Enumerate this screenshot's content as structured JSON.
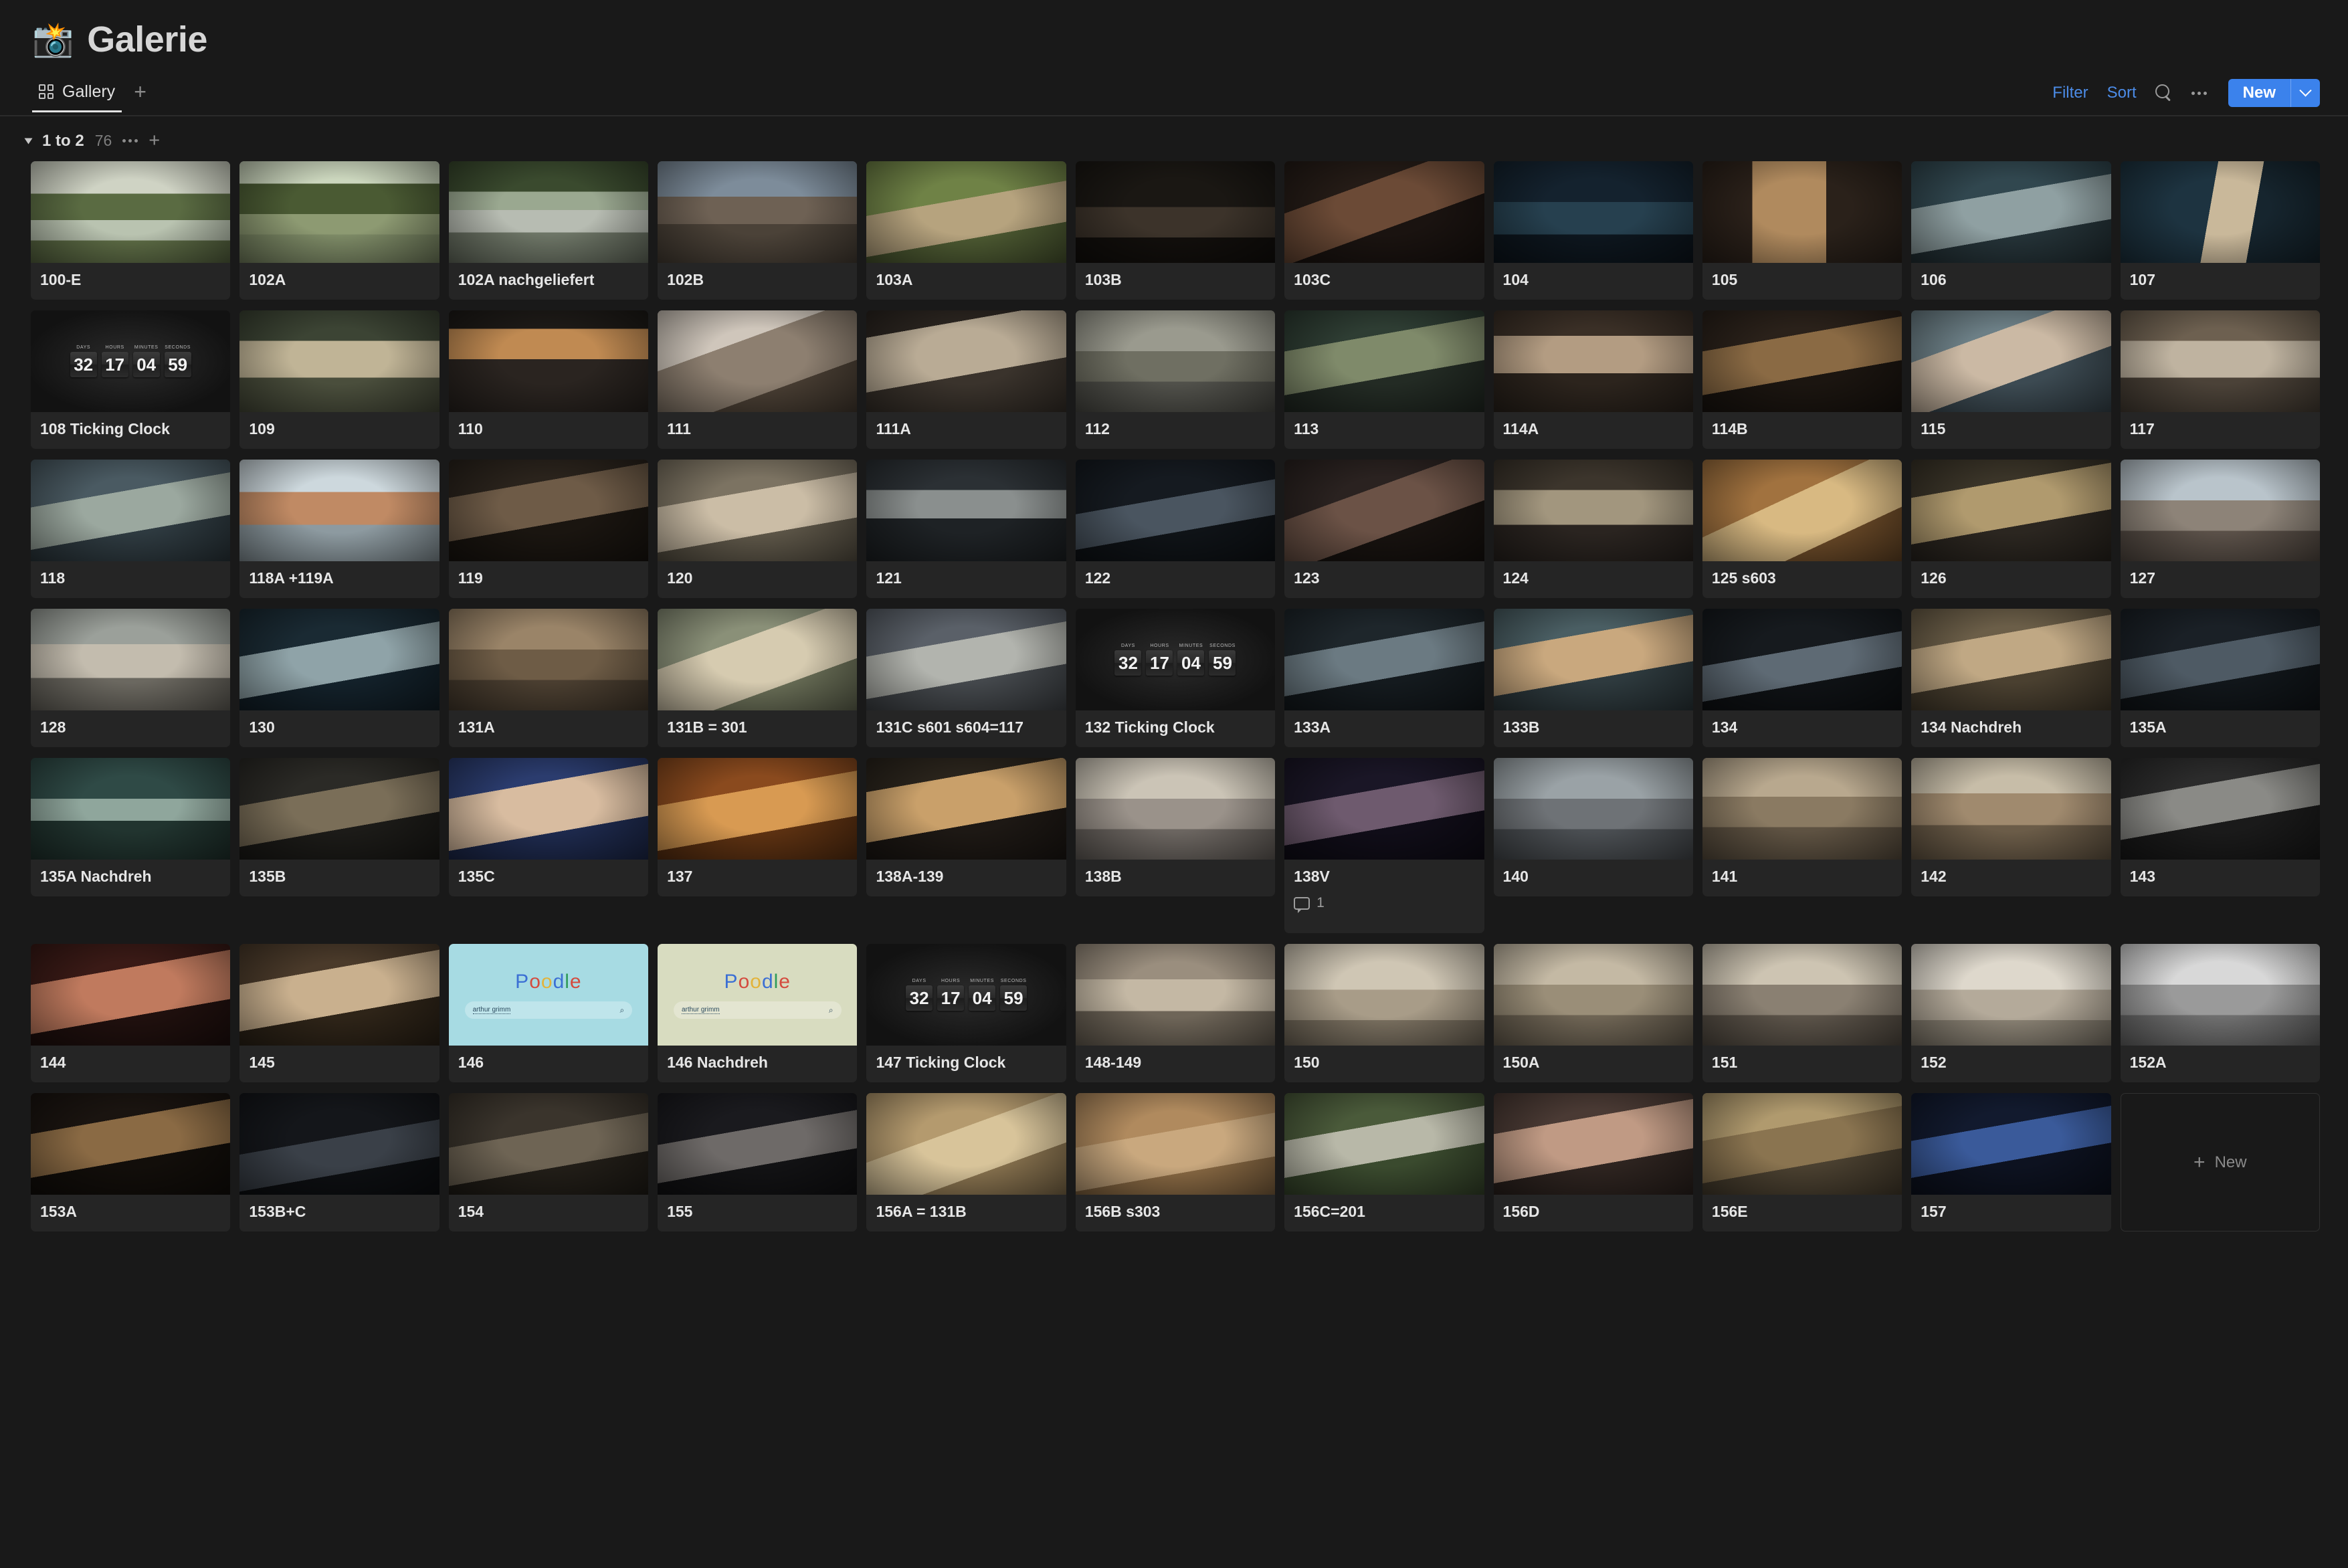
{
  "header": {
    "emoji": "📸",
    "emoji_name": "camera-with-flash",
    "title": "Galerie"
  },
  "viewbar": {
    "tabs": [
      {
        "label": "Gallery",
        "icon": "grid-icon",
        "active": true
      }
    ],
    "add_view_label": "+",
    "filter_label": "Filter",
    "sort_label": "Sort",
    "search_icon": "search-icon",
    "more_icon": "ellipsis-icon",
    "new_label": "New",
    "new_caret_icon": "chevron-down-icon",
    "accent_color": "#3b82ec",
    "link_color": "#4c8ce8"
  },
  "group": {
    "caret_icon": "triangle-down-icon",
    "name": "1 to 2",
    "count": "76",
    "more_icon": "ellipsis-icon",
    "add_icon": "plus-icon"
  },
  "clock": {
    "captions": [
      "DAYS",
      "HOURS",
      "MINUTES",
      "SECONDS"
    ],
    "values": [
      "32",
      "17",
      "04",
      "59"
    ]
  },
  "poodle": {
    "logo": "Poodle",
    "query": "arthur grimm",
    "search_icon": "magnifier-icon"
  },
  "new_card": {
    "plus": "+",
    "label": "New"
  },
  "cards": [
    {
      "label": "100-E",
      "art": "lake"
    },
    {
      "label": "102A",
      "art": "pavilion"
    },
    {
      "label": "102A nachgeliefert",
      "art": "bridge"
    },
    {
      "label": "102B",
      "art": "cyclists"
    },
    {
      "label": "103A",
      "art": "woman-garden"
    },
    {
      "label": "103B",
      "art": "dark-interior"
    },
    {
      "label": "103C",
      "art": "stairwell"
    },
    {
      "label": "104",
      "art": "dark-blue"
    },
    {
      "label": "105",
      "art": "window-woman"
    },
    {
      "label": "106",
      "art": "sleeping"
    },
    {
      "label": "107",
      "art": "blue-room"
    },
    {
      "label": "108 Ticking Clock",
      "art": "clock"
    },
    {
      "label": "109",
      "art": "group-outdoor"
    },
    {
      "label": "110",
      "art": "kitchen-woman"
    },
    {
      "label": "111",
      "art": "corridor-woman"
    },
    {
      "label": "111A",
      "art": "street-woman"
    },
    {
      "label": "112",
      "art": "facade"
    },
    {
      "label": "113",
      "art": "couple-embrace"
    },
    {
      "label": "114A",
      "art": "two-women"
    },
    {
      "label": "114B",
      "art": "cafe"
    },
    {
      "label": "115",
      "art": "portrait-blue"
    },
    {
      "label": "117",
      "art": "three-women"
    },
    {
      "label": "118",
      "art": "phone-woman"
    },
    {
      "label": "118A +119A",
      "art": "bed-man"
    },
    {
      "label": "119",
      "art": "phone-dark"
    },
    {
      "label": "120",
      "art": "beige-woman"
    },
    {
      "label": "121",
      "art": "bathroom"
    },
    {
      "label": "122",
      "art": "interior-dark"
    },
    {
      "label": "123",
      "art": "silhouette"
    },
    {
      "label": "124",
      "art": "crowd-hall"
    },
    {
      "label": "125 s603",
      "art": "warm-blur"
    },
    {
      "label": "126",
      "art": "meeting"
    },
    {
      "label": "127",
      "art": "window-group"
    },
    {
      "label": "128",
      "art": "group-standing"
    },
    {
      "label": "130",
      "art": "bathtub"
    },
    {
      "label": "131A",
      "art": "wall-texture"
    },
    {
      "label": "131B = 301",
      "art": "face-profile"
    },
    {
      "label": "131C s601 s604=117",
      "art": "street-couple"
    },
    {
      "label": "132 Ticking Clock",
      "art": "clock"
    },
    {
      "label": "133A",
      "art": "room-two"
    },
    {
      "label": "133B",
      "art": "two-talking"
    },
    {
      "label": "134",
      "art": "office-night"
    },
    {
      "label": "134 Nachdreh",
      "art": "lying-ground"
    },
    {
      "label": "135A",
      "art": "bed-dark"
    },
    {
      "label": "135A Nachdreh",
      "art": "wreath"
    },
    {
      "label": "135B",
      "art": "rooftop"
    },
    {
      "label": "135C",
      "art": "portrait-blue2"
    },
    {
      "label": "137",
      "art": "orange-room"
    },
    {
      "label": "138A-139",
      "art": "woman-phone2"
    },
    {
      "label": "138B",
      "art": "lamp-room"
    },
    {
      "label": "138V",
      "art": "stage-couple",
      "comments": "1"
    },
    {
      "label": "140",
      "art": "station"
    },
    {
      "label": "141",
      "art": "alley"
    },
    {
      "label": "142",
      "art": "window-pair"
    },
    {
      "label": "143",
      "art": "spiral"
    },
    {
      "label": "144",
      "art": "woman-red"
    },
    {
      "label": "145",
      "art": "scarf-woman"
    },
    {
      "label": "146",
      "art": "poodle"
    },
    {
      "label": "146 Nachdreh",
      "art": "poodle-light"
    },
    {
      "label": "147 Ticking Clock",
      "art": "clock"
    },
    {
      "label": "148-149",
      "art": "square-crowd"
    },
    {
      "label": "150",
      "art": "corridor-pale"
    },
    {
      "label": "150A",
      "art": "courtyard"
    },
    {
      "label": "151",
      "art": "man-hall"
    },
    {
      "label": "152",
      "art": "white-room"
    },
    {
      "label": "152A",
      "art": "snow-fence"
    },
    {
      "label": "153A",
      "art": "night-woman"
    },
    {
      "label": "153B+C",
      "art": "dark-wall"
    },
    {
      "label": "154",
      "art": "cave"
    },
    {
      "label": "155",
      "art": "bed-night"
    },
    {
      "label": "156A = 131B",
      "art": "face-warm"
    },
    {
      "label": "156B s303",
      "art": "beetle"
    },
    {
      "label": "156C=201",
      "art": "cross-grave"
    },
    {
      "label": "156D",
      "art": "redhead"
    },
    {
      "label": "156E",
      "art": "doorway"
    },
    {
      "label": "157",
      "art": "police-car"
    }
  ]
}
